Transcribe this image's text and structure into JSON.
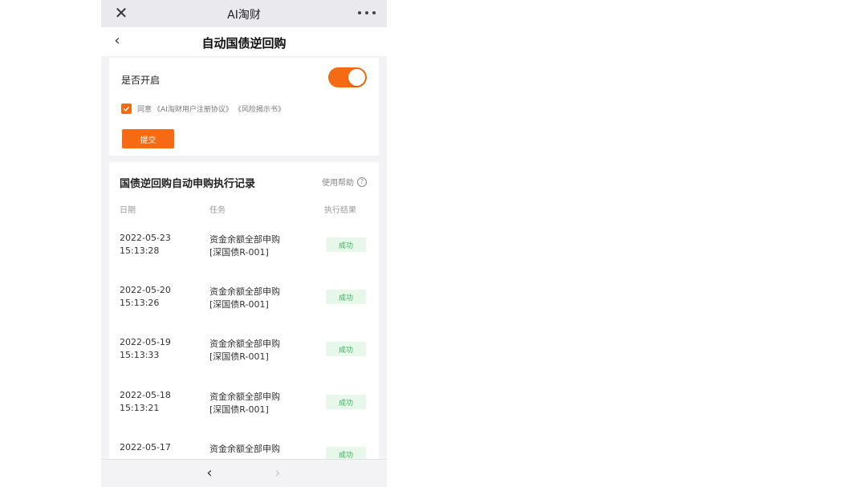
{
  "window": {
    "title": "AI淘财"
  },
  "nav": {
    "page_title": "自动国债逆回购"
  },
  "settings": {
    "enable_label": "是否开启",
    "enabled": true,
    "agree_checked": true,
    "agree_prefix": "同意",
    "agreement_1": "《AI淘财用户注册协议》",
    "agreement_2": "《风险揭示书》",
    "submit_label": "提交"
  },
  "records": {
    "title": "国债逆回购自动申购执行记录",
    "help_label": "使用帮助",
    "help_icon_glyph": "?",
    "columns": {
      "date": "日期",
      "task": "任务",
      "result": "执行结果"
    },
    "rows": [
      {
        "date": "2022-05-23",
        "time": "15:13:28",
        "task_line1": "资金余额全部申购",
        "task_line2": "[深国债R-001]",
        "result": "成功"
      },
      {
        "date": "2022-05-20",
        "time": "15:13:26",
        "task_line1": "资金余额全部申购",
        "task_line2": "[深国债R-001]",
        "result": "成功"
      },
      {
        "date": "2022-05-19",
        "time": "15:13:33",
        "task_line1": "资金余额全部申购",
        "task_line2": "[深国债R-001]",
        "result": "成功"
      },
      {
        "date": "2022-05-18",
        "time": "15:13:21",
        "task_line1": "资金余额全部申购",
        "task_line2": "[深国债R-001]",
        "result": "成功"
      },
      {
        "date": "2022-05-17",
        "time": "",
        "task_line1": "资金余额全部申购",
        "task_line2": "",
        "result": "成功"
      }
    ]
  },
  "colors": {
    "accent": "#f56a12",
    "success_text": "#34b35a",
    "success_bg": "#e7f8ea"
  },
  "icons": {
    "close": "close-icon",
    "more": "more-icon",
    "back": "chevron-left-icon",
    "check": "checkmark-icon",
    "help": "help-icon",
    "prev": "chevron-left-icon",
    "next": "chevron-right-icon"
  }
}
